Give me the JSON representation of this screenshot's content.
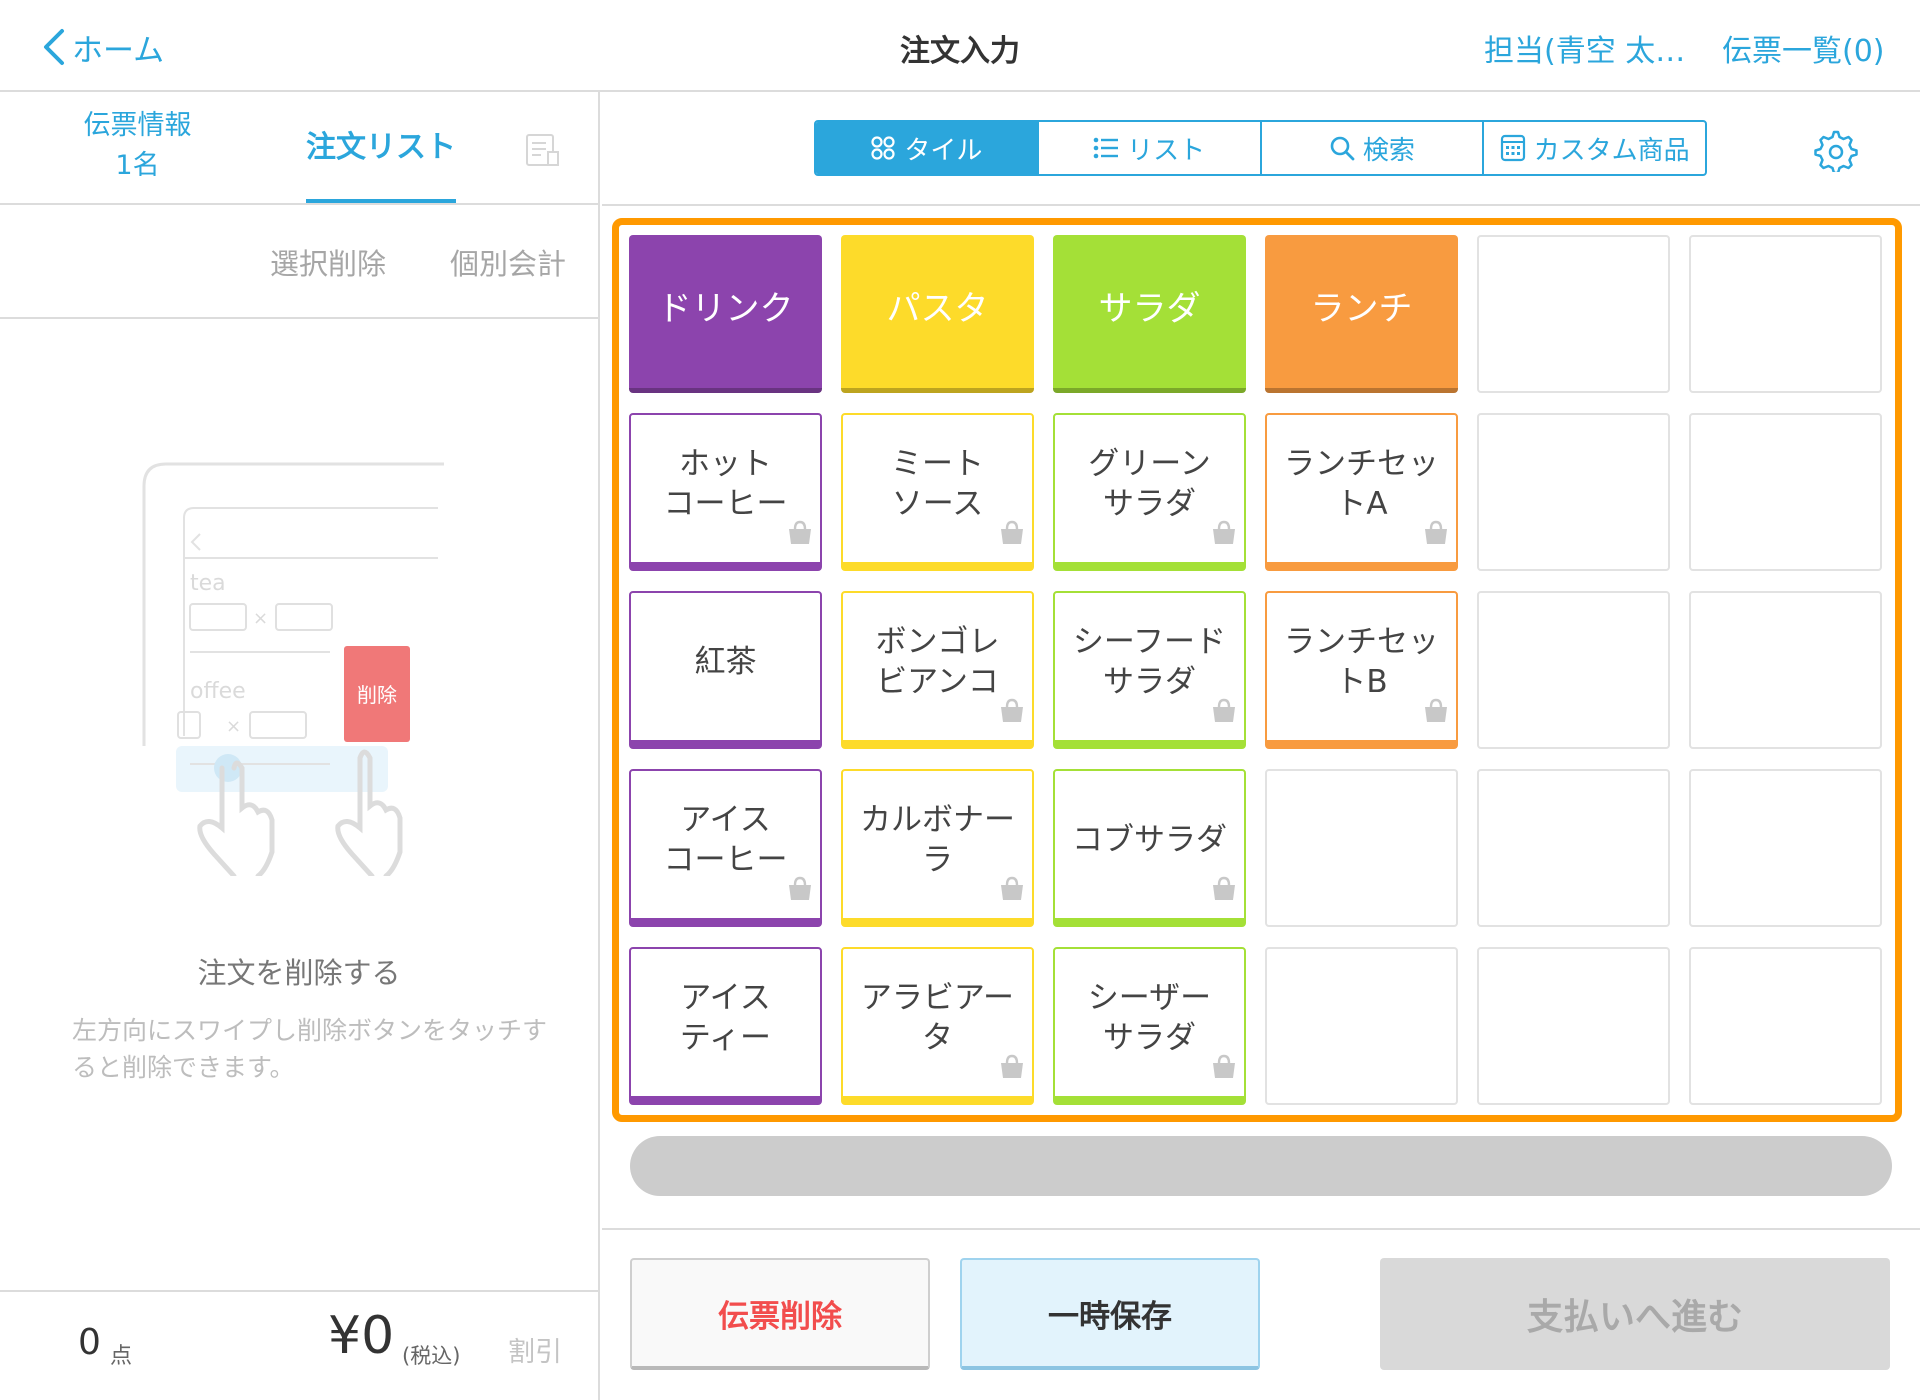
{
  "header": {
    "back_label": "ホーム",
    "title": "注文入力",
    "staff_label": "担当(青空 太…",
    "slips_label": "伝票一覧(0)"
  },
  "left": {
    "tab_info_label": "伝票情報",
    "tab_info_count": "1名",
    "tab_orders_label": "注文リスト",
    "select_delete_label": "選択削除",
    "split_payment_label": "個別会計",
    "illustration": {
      "item1": "tea",
      "item2": "offee",
      "delete_label": "削除",
      "times": "×"
    },
    "empty_title": "注文を削除する",
    "empty_desc": "左方向にスワイプし削除ボタンをタッチすると削除できます。",
    "footer": {
      "count": "0",
      "count_unit": "点",
      "total": "¥0",
      "tax_label": "(税込)",
      "discount_label": "割引"
    }
  },
  "view_modes": [
    {
      "label": "タイル",
      "icon": "tiles-icon",
      "active": true
    },
    {
      "label": "リスト",
      "icon": "list-icon",
      "active": false
    },
    {
      "label": "検索",
      "icon": "search-icon",
      "active": false
    },
    {
      "label": "カスタム商品",
      "icon": "calculator-icon",
      "active": false
    }
  ],
  "colors": {
    "accent": "#2ba6dc",
    "highlight": "#ff9900",
    "drink": "#8c44ad",
    "pasta": "#fddb2a",
    "salad": "#a4e037",
    "lunch": "#f89b40",
    "danger": "#f24d4d"
  },
  "tiles": [
    {
      "type": "cat",
      "label": "ドリンク",
      "color": "#8c44ad"
    },
    {
      "type": "cat",
      "label": "パスタ",
      "color": "#fddb2a"
    },
    {
      "type": "cat",
      "label": "サラダ",
      "color": "#a4e037"
    },
    {
      "type": "cat",
      "label": "ランチ",
      "color": "#f89b40"
    },
    {
      "type": "empty"
    },
    {
      "type": "empty"
    },
    {
      "type": "item",
      "label": "ホット\nコーヒー",
      "color": "#8c44ad",
      "takeout": true
    },
    {
      "type": "item",
      "label": "ミート\nソース",
      "color": "#fddb2a",
      "takeout": true
    },
    {
      "type": "item",
      "label": "グリーン\nサラダ",
      "color": "#a4e037",
      "takeout": true
    },
    {
      "type": "item",
      "label": "ランチセッ\nトA",
      "color": "#f89b40",
      "takeout": true
    },
    {
      "type": "empty"
    },
    {
      "type": "empty"
    },
    {
      "type": "item",
      "label": "紅茶",
      "color": "#8c44ad",
      "takeout": false
    },
    {
      "type": "item",
      "label": "ボンゴレ\nビアンコ",
      "color": "#fddb2a",
      "takeout": true
    },
    {
      "type": "item",
      "label": "シーフード\nサラダ",
      "color": "#a4e037",
      "takeout": true
    },
    {
      "type": "item",
      "label": "ランチセッ\nトB",
      "color": "#f89b40",
      "takeout": true
    },
    {
      "type": "empty"
    },
    {
      "type": "empty"
    },
    {
      "type": "item",
      "label": "アイス\nコーヒー",
      "color": "#8c44ad",
      "takeout": true
    },
    {
      "type": "item",
      "label": "カルボナー\nラ",
      "color": "#fddb2a",
      "takeout": true
    },
    {
      "type": "item",
      "label": "コブサラダ",
      "color": "#a4e037",
      "takeout": true
    },
    {
      "type": "empty"
    },
    {
      "type": "empty"
    },
    {
      "type": "empty"
    },
    {
      "type": "item",
      "label": "アイス\nティー",
      "color": "#8c44ad",
      "takeout": false
    },
    {
      "type": "item",
      "label": "アラビアー\nタ",
      "color": "#fddb2a",
      "takeout": true
    },
    {
      "type": "item",
      "label": "シーザー\nサラダ",
      "color": "#a4e037",
      "takeout": true
    },
    {
      "type": "empty"
    },
    {
      "type": "empty"
    },
    {
      "type": "empty"
    }
  ],
  "actions": {
    "delete_slip": "伝票削除",
    "hold": "一時保存",
    "pay": "支払いへ進む"
  }
}
